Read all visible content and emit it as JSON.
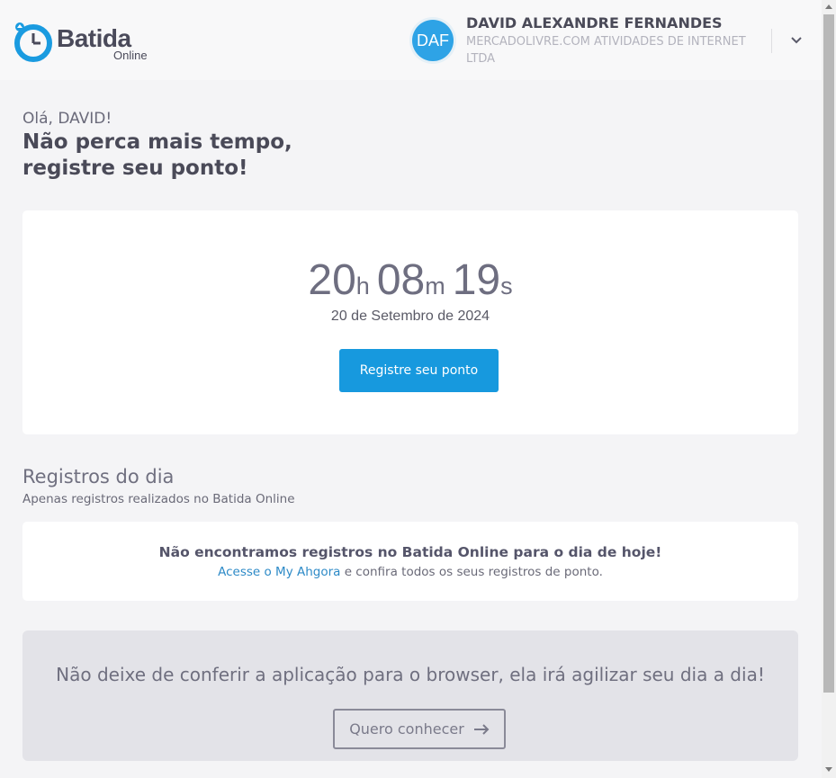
{
  "header": {
    "logo_text": "Batida",
    "logo_sub": "Online",
    "avatar_initials": "DAF",
    "user_name": "DAVID ALEXANDRE FERNANDES",
    "company": "MERCADOLIVRE.COM ATIVIDADES DE INTERNET LTDA"
  },
  "main": {
    "greeting": "Olá, DAVID!",
    "headline_1": "Não perca mais tempo,",
    "headline_2": "registre seu ponto!",
    "clock": {
      "hours": "20",
      "h_unit": "h",
      "minutes": "08",
      "m_unit": "m",
      "seconds": "19",
      "s_unit": "s"
    },
    "date": "20 de Setembro de 2024",
    "register_button": "Registre seu ponto"
  },
  "records": {
    "title": "Registros do dia",
    "subtitle": "Apenas registros realizados no Batida Online",
    "empty_message": "Não encontramos registros no Batida Online para o dia de hoje!",
    "link_text": "Acesse o My Ahgora",
    "link_suffix": " e confira todos os seus registros de ponto."
  },
  "promo": {
    "text": "Não deixe de conferir a aplicação para o browser, ela irá agilizar seu dia a dia!",
    "button_label": "Quero conhecer"
  },
  "colors": {
    "primary": "#1799de",
    "avatar": "#2ea3e6",
    "background": "#f4f4f6"
  }
}
